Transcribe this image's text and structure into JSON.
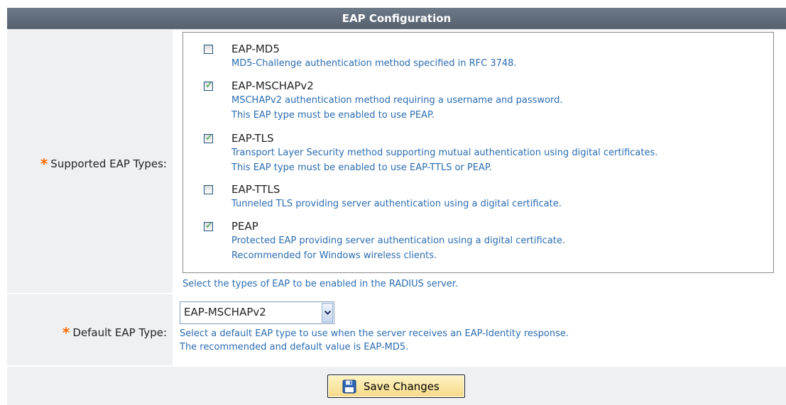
{
  "panel": {
    "title": "EAP Configuration"
  },
  "supported": {
    "required_mark": "*",
    "label": "Supported EAP Types:",
    "help": "Select the types of EAP to be enabled in the RADIUS server.",
    "types": [
      {
        "name": "EAP-MD5",
        "checked": false,
        "desc": [
          "MD5-Challenge authentication method specified in RFC 3748."
        ]
      },
      {
        "name": "EAP-MSCHAPv2",
        "checked": true,
        "desc": [
          "MSCHAPv2 authentication method requiring a username and password.",
          "This EAP type must be enabled to use PEAP."
        ]
      },
      {
        "name": "EAP-TLS",
        "checked": true,
        "desc": [
          "Transport Layer Security method supporting mutual authentication using digital certificates.",
          "This EAP type must be enabled to use EAP-TTLS or PEAP."
        ]
      },
      {
        "name": "EAP-TTLS",
        "checked": false,
        "desc": [
          "Tunneled TLS providing server authentication using a digital certificate."
        ]
      },
      {
        "name": "PEAP",
        "checked": true,
        "desc": [
          "Protected EAP providing server authentication using a digital certificate.",
          "Recommended for Windows wireless clients."
        ]
      }
    ]
  },
  "default_type": {
    "required_mark": "*",
    "label": "Default EAP Type:",
    "selected": "EAP-MSCHAPv2",
    "help": [
      "Select a default EAP type to use when the server receives an EAP-Identity response.",
      "The recommended and default value is EAP-MD5."
    ]
  },
  "actions": {
    "save_label": "Save Changes"
  },
  "colors": {
    "header_bg": "#5f6b79",
    "label_bg": "#eef0f2",
    "help_text": "#2b6cb0",
    "required": "#ff6a00",
    "check": "#21a121"
  }
}
